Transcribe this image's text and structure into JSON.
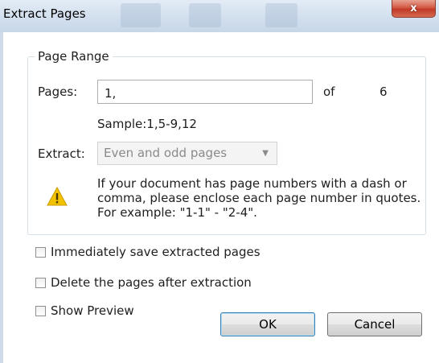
{
  "window": {
    "title": "Extract Pages",
    "close_label": "x"
  },
  "page_range": {
    "legend": "Page Range",
    "pages_label": "Pages:",
    "pages_value": "1,",
    "of_label": "of",
    "total_pages": "6",
    "sample_text": "Sample:1,5-9,12",
    "extract_label": "Extract:",
    "extract_selected": "Even and odd pages",
    "warning_text": "If your document has page numbers with a dash or comma, please enclose each page number in quotes. For example: \"1-1\" - \"2-4\"."
  },
  "options": {
    "save_immediately": "Immediately save extracted pages",
    "delete_after": "Delete the pages after extraction",
    "show_preview": "Show Preview"
  },
  "buttons": {
    "ok": "OK",
    "cancel": "Cancel"
  },
  "colors": {
    "warning": "#f2c200",
    "close_button": "#c13a26"
  }
}
